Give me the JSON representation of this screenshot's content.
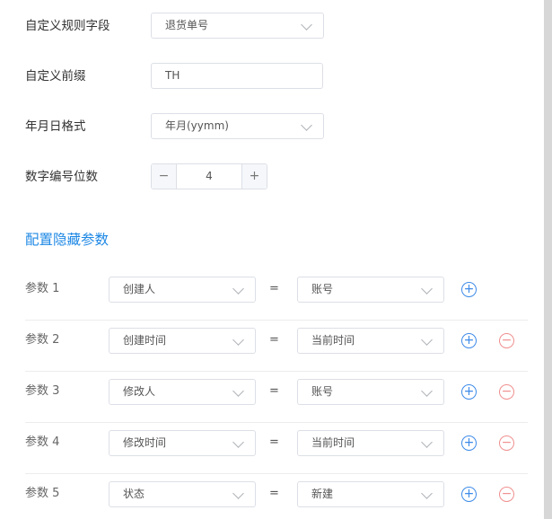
{
  "form": {
    "rule_field": {
      "label": "自定义规则字段",
      "value": "退货单号"
    },
    "prefix": {
      "label": "自定义前缀",
      "value": "TH"
    },
    "date_format": {
      "label": "年月日格式",
      "value": "年月(yymm)"
    },
    "digits": {
      "label": "数字编号位数",
      "value": "4",
      "minus": "−",
      "plus": "+"
    }
  },
  "hidden_params": {
    "title": "配置隐藏参数",
    "equals": "=",
    "add_symbol": "+",
    "remove_symbol": "−",
    "rows": [
      {
        "label": "参数 1",
        "field": "创建人",
        "value": "账号"
      },
      {
        "label": "参数 2",
        "field": "创建时间",
        "value": "当前时间"
      },
      {
        "label": "参数 3",
        "field": "修改人",
        "value": "账号"
      },
      {
        "label": "参数 4",
        "field": "修改时间",
        "value": "当前时间"
      },
      {
        "label": "参数 5",
        "field": "状态",
        "value": "新建"
      }
    ]
  },
  "colors": {
    "accent": "#1e88e5",
    "remove": "#f08f8f",
    "border": "#dcdfe6"
  }
}
